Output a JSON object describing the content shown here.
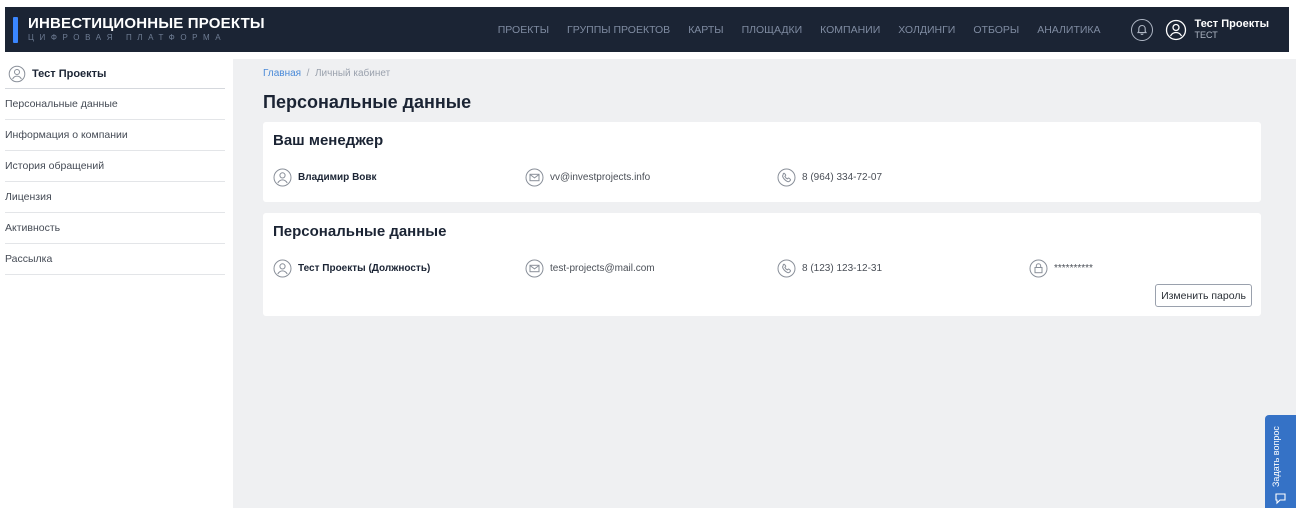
{
  "header": {
    "logo_title": "ИНВЕСТИЦИОННЫЕ ПРОЕКТЫ",
    "logo_subtitle": "ЦИФРОВАЯ ПЛАТФОРМА",
    "nav": [
      "ПРОЕКТЫ",
      "ГРУППЫ ПРОЕКТОВ",
      "КАРТЫ",
      "ПЛОЩАДКИ",
      "КОМПАНИИ",
      "ХОЛДИНГИ",
      "ОТБОРЫ",
      "АНАЛИТИКА"
    ],
    "user_name": "Тест Проекты",
    "user_role": "ТЕСТ"
  },
  "sidebar": {
    "profile_label": "Тест Проекты",
    "items": [
      {
        "label": "Персональные данные"
      },
      {
        "label": "Информация о компании"
      },
      {
        "label": "История обращений"
      },
      {
        "label": "Лицензия"
      },
      {
        "label": "Активность"
      },
      {
        "label": "Рассылка"
      }
    ]
  },
  "breadcrumb": {
    "home": "Главная",
    "separator": "/",
    "current": "Личный кабинет"
  },
  "page_title": "Персональные данные",
  "manager_card": {
    "title": "Ваш менеджер",
    "name": "Владимир Вовк",
    "email": "vv@investprojects.info",
    "phone": "8 (964) 334-72-07"
  },
  "personal_card": {
    "title": "Персональные данные",
    "name": "Тест Проекты (Должность)",
    "email": "test-projects@mail.com",
    "phone": "8 (123) 123-12-31",
    "password": "**********",
    "change_password_label": "Изменить пароль"
  },
  "ask_question": {
    "label": "Задать вопрос"
  },
  "icons": {
    "user": "user-icon",
    "mail": "mail-icon",
    "phone": "phone-icon",
    "lock": "lock-icon",
    "bell": "bell-icon",
    "chat": "chat-icon"
  },
  "colors": {
    "topbar": "#1b2434",
    "accent": "#3a86ff",
    "link": "#4a8ad8",
    "main_bg": "#eff0f2",
    "ask_tab": "#3572c6"
  }
}
